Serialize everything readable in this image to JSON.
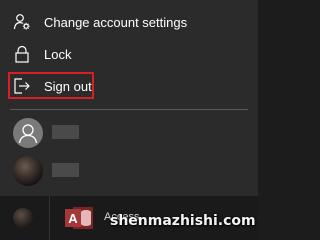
{
  "menu": {
    "items": [
      {
        "label": "Change account settings",
        "icon": "person-gear-icon"
      },
      {
        "label": "Lock",
        "icon": "lock-icon"
      },
      {
        "label": "Sign out",
        "icon": "sign-out-icon"
      }
    ],
    "highlight_color": "#d61f26"
  },
  "taskbar": {
    "app_label": "Access",
    "app_icon": "access-icon",
    "app_icon_letter": "A",
    "app_color": "#a4373a"
  },
  "watermark": "shenmazhishi.com"
}
